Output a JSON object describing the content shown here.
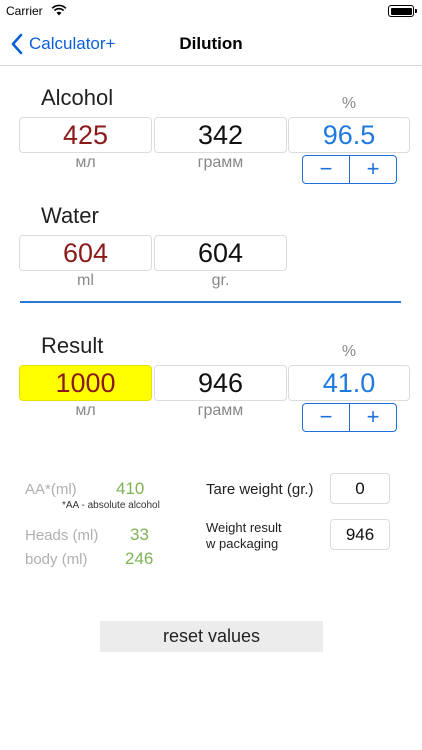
{
  "status_bar": {
    "carrier": "Carrier"
  },
  "nav": {
    "back_label": "Calculator+",
    "title": "Dilution"
  },
  "alcohol": {
    "title": "Alcohol",
    "volume": "425",
    "volume_unit": "мл",
    "weight": "342",
    "weight_unit": "грамм",
    "percent_label": "%",
    "percent": "96.5",
    "minus": "−",
    "plus": "+"
  },
  "water": {
    "title": "Water",
    "volume": "604",
    "volume_unit": "ml",
    "weight": "604",
    "weight_unit": "gr."
  },
  "result": {
    "title": "Result",
    "volume": "1000",
    "volume_unit": "мл",
    "weight": "946",
    "weight_unit": "грамм",
    "percent_label": "%",
    "percent": "41.0",
    "minus": "−",
    "plus": "+"
  },
  "stats": {
    "aa_label": "AA*(ml)",
    "aa_value": "410",
    "aa_note": "*AA - absolute alcohol",
    "heads_label": "Heads (ml)",
    "heads_value": "33",
    "body_label": "body (ml)",
    "body_value": "246"
  },
  "tare": {
    "label": "Tare weight (gr.)",
    "value": "0"
  },
  "weight_result": {
    "label_line1": "Weight result",
    "label_line2": "w packaging",
    "value": "946"
  },
  "reset_label": "reset values",
  "colors": {
    "accent": "#1f7ae0",
    "volume_red": "#8b1a1a",
    "highlight": "#ffff00",
    "stat_green": "#7db354"
  }
}
